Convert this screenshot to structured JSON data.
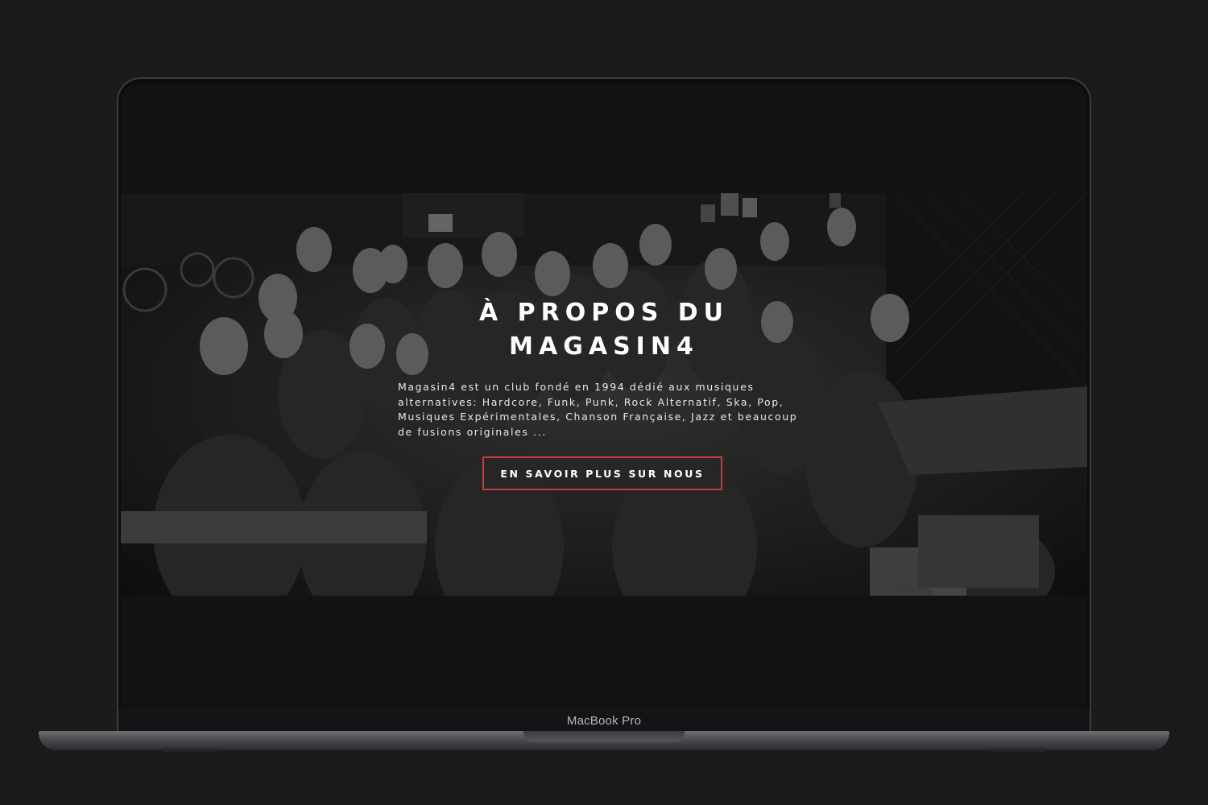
{
  "device": {
    "model_label": "MacBook Pro"
  },
  "hero": {
    "title_line1": "À PROPOS DU",
    "title_line2": "MAGASIN4",
    "description": "Magasin4 est un club fondé en 1994 dédié aux musiques alternatives: Hardcore, Funk, Punk, Rock Alternatif, Ska, Pop, Musiques Expérimentales, Chanson Française, Jazz et beaucoup de fusions originales ...",
    "cta_label": "EN SAVOIR PLUS SUR NOUS",
    "cta_border_color": "#e0322f",
    "photo_style": "black-and-white group photo"
  }
}
